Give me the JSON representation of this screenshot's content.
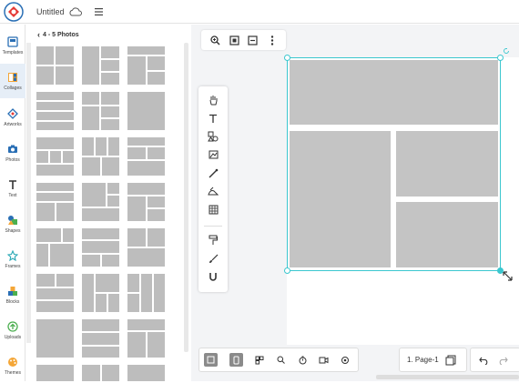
{
  "header": {
    "doc_title": "Untitled"
  },
  "rail": {
    "items": [
      {
        "label": "Templates",
        "icon": "templates-icon"
      },
      {
        "label": "Collages",
        "icon": "collages-icon",
        "active": true
      },
      {
        "label": "Artworks",
        "icon": "artworks-icon"
      },
      {
        "label": "Photos",
        "icon": "photos-icon"
      },
      {
        "label": "Text",
        "icon": "text-icon"
      },
      {
        "label": "Shapes",
        "icon": "shapes-icon"
      },
      {
        "label": "Frames",
        "icon": "frames-icon"
      },
      {
        "label": "Blocks",
        "icon": "blocks-icon"
      },
      {
        "label": "Uploads",
        "icon": "uploads-icon"
      },
      {
        "label": "Themes",
        "icon": "themes-icon"
      }
    ]
  },
  "panel": {
    "title": "4 - 5 Photos"
  },
  "pager": {
    "label": "1. Page-1"
  },
  "colors": {
    "accent": "#3bc7cf",
    "placeholder": "#c4c4c4",
    "active_rail": "#e6eef7"
  }
}
